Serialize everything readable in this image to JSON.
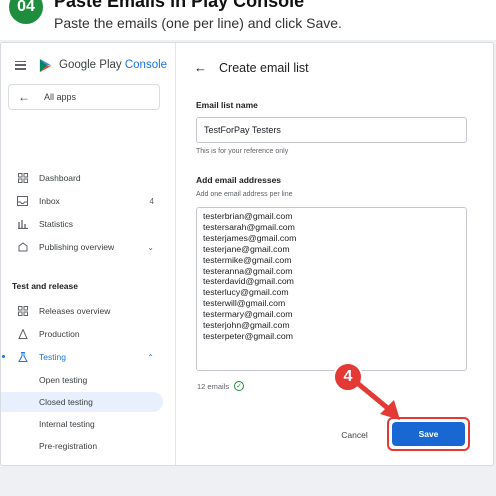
{
  "header": {
    "step_number": "04",
    "title": "Paste Emails in Play Console",
    "subtitle": "Paste the emails (one per line) and click Save."
  },
  "sidebar": {
    "brand": "Google Play",
    "brand_accent": "Console",
    "all_apps": "All apps",
    "items": [
      {
        "label": "Dashboard",
        "icon": "dashboard-icon"
      },
      {
        "label": "Inbox",
        "icon": "inbox-icon",
        "count": "4"
      },
      {
        "label": "Statistics",
        "icon": "statistics-icon"
      },
      {
        "label": "Publishing overview",
        "icon": "publishing-icon"
      }
    ],
    "section_title": "Test and release",
    "release_items": [
      {
        "label": "Releases overview",
        "icon": "releases-icon"
      },
      {
        "label": "Production",
        "icon": "production-icon"
      },
      {
        "label": "Testing",
        "icon": "testing-icon"
      }
    ],
    "testing_sub": [
      {
        "label": "Open testing"
      },
      {
        "label": "Closed testing",
        "active": true
      },
      {
        "label": "Internal testing"
      },
      {
        "label": "Pre-registration"
      }
    ]
  },
  "main": {
    "title": "Create email list",
    "list_name_label": "Email list name",
    "list_name_value": "TestForPay Testers",
    "list_name_help": "This is for your reference only",
    "emails_label": "Add email addresses",
    "emails_help": "Add one email address per line",
    "emails": [
      "testerbrian@gmail.com",
      "testersarah@gmail.com",
      "testerjames@gmail.com",
      "testerjane@gmail.com",
      "testermike@gmail.com",
      "testeranna@gmail.com",
      "testerdavid@gmail.com",
      "testerlucy@gmail.com",
      "testerwill@gmail.com",
      "testermary@gmail.com",
      "testerjohn@gmail.com",
      "testerpeter@gmail.com"
    ],
    "email_count": "12 emails",
    "cancel_label": "Cancel",
    "save_label": "Save"
  },
  "annotation": {
    "step_marker": "4"
  },
  "colors": {
    "accent": "#1a73e8",
    "save_button": "#1967d2",
    "highlight": "#e53935",
    "success": "#1e8e3e",
    "active_nav": "#e8f0fe"
  }
}
